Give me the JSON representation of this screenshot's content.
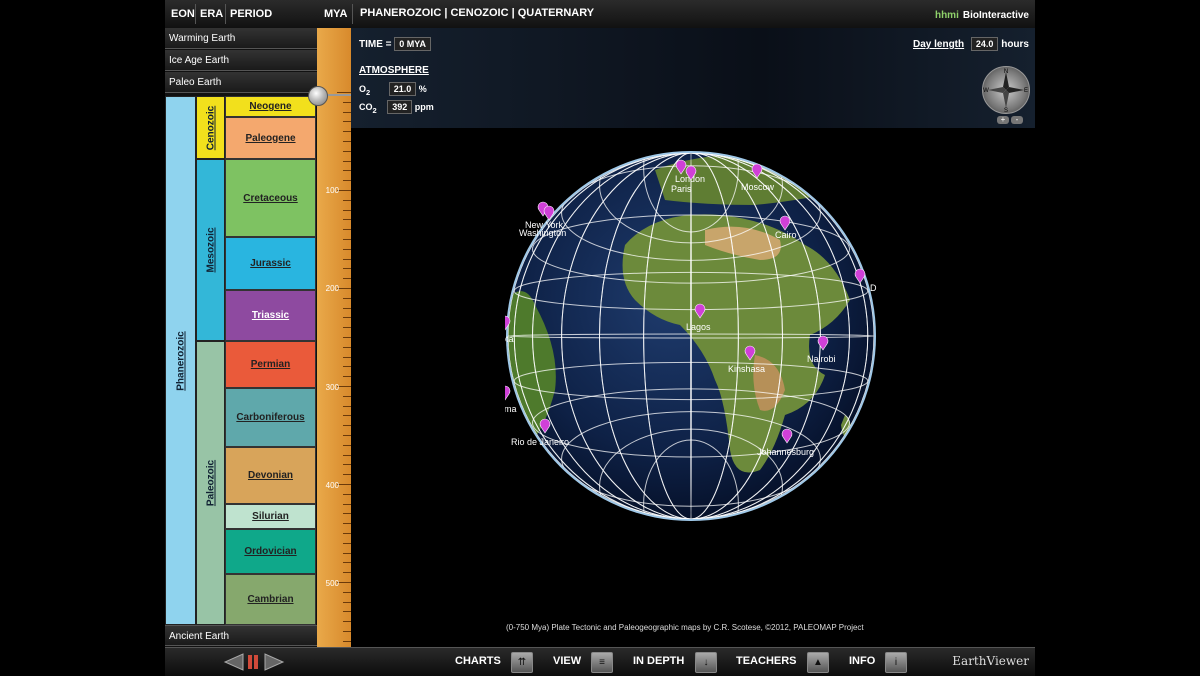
{
  "topbar": {
    "eon": "EON",
    "era": "ERA",
    "period": "PERIOD",
    "mya": "MYA",
    "breadcrumb": "PHANEROZOIC | CENOZOIC | QUATERNARY",
    "brand_hhmi": "hhmi",
    "brand_name": "BioInteractive"
  },
  "presets": [
    "Warming Earth",
    "Ice Age Earth",
    "Paleo Earth"
  ],
  "ancient": "Ancient Earth",
  "eon_label": "Phanerozoic",
  "eras": [
    "Cenozoic",
    "Mesozoic",
    "Paleozoic"
  ],
  "periods": [
    "Neogene",
    "Paleogene",
    "Cretaceous",
    "Jurassic",
    "Triassic",
    "Permian",
    "Carboniferous",
    "Devonian",
    "Silurian",
    "Ordovician",
    "Cambrian"
  ],
  "ruler_labels": [
    "100",
    "200",
    "300",
    "400",
    "500"
  ],
  "info": {
    "time_label": "TIME =",
    "time_value": "0 MYA",
    "atmosphere": "ATMOSPHERE",
    "o2_label": "O",
    "o2_sub": "2",
    "o2_value": "21.0",
    "o2_unit": "%",
    "co2_label": "CO",
    "co2_sub": "2",
    "co2_value": "392",
    "co2_unit": "ppm",
    "day_length_label": "Day length",
    "day_length_value": "24.0",
    "day_length_unit": "hours"
  },
  "compass": {
    "n": "N",
    "s": "S",
    "e": "E",
    "w": "W"
  },
  "zoom": {
    "plus": "+",
    "minus": "-"
  },
  "cities": [
    "London",
    "Paris",
    "Moscow",
    "New York",
    "Washington",
    "Cairo",
    "Dubai",
    "Lagos",
    "Bogota",
    "Nairobi",
    "Kinshasa",
    "Lima",
    "Rio de Janeiro",
    "Johannesburg"
  ],
  "credit": "(0-750 Mya) Plate Tectonic and Paleogeographic maps by C.R. Scotese, ©2012, PALEOMAP Project",
  "bottombar": {
    "charts": "CHARTS",
    "view": "VIEW",
    "in_depth": "IN DEPTH",
    "teachers": "TEACHERS",
    "info": "INFO",
    "app_name": "EarthViewer"
  },
  "colors": {
    "neogene": "#f2e01c",
    "paleogene": "#f4a86e",
    "cretaceous": "#7ec262",
    "jurassic": "#29b5e0",
    "triassic": "#8e4aa0",
    "permian": "#ea5a3a",
    "carboniferous": "#5fa8ab",
    "devonian": "#d8a45a",
    "silurian": "#bfe3cf",
    "ordovician": "#0fa88a",
    "cambrian": "#86a86d",
    "cenozoic": "#f2e01c",
    "mesozoic": "#33b7d8",
    "paleozoic": "#98c4a6",
    "phanerozoic": "#8fd3ee",
    "pin": "#d040d8"
  }
}
